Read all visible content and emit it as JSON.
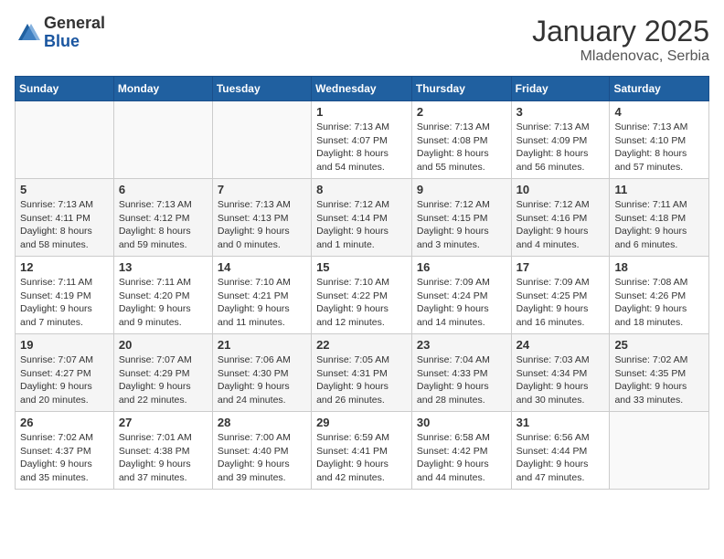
{
  "logo": {
    "general": "General",
    "blue": "Blue"
  },
  "title": "January 2025",
  "location": "Mladenovac, Serbia",
  "weekdays": [
    "Sunday",
    "Monday",
    "Tuesday",
    "Wednesday",
    "Thursday",
    "Friday",
    "Saturday"
  ],
  "weeks": [
    [
      {
        "day": "",
        "info": ""
      },
      {
        "day": "",
        "info": ""
      },
      {
        "day": "",
        "info": ""
      },
      {
        "day": "1",
        "info": "Sunrise: 7:13 AM\nSunset: 4:07 PM\nDaylight: 8 hours\nand 54 minutes."
      },
      {
        "day": "2",
        "info": "Sunrise: 7:13 AM\nSunset: 4:08 PM\nDaylight: 8 hours\nand 55 minutes."
      },
      {
        "day": "3",
        "info": "Sunrise: 7:13 AM\nSunset: 4:09 PM\nDaylight: 8 hours\nand 56 minutes."
      },
      {
        "day": "4",
        "info": "Sunrise: 7:13 AM\nSunset: 4:10 PM\nDaylight: 8 hours\nand 57 minutes."
      }
    ],
    [
      {
        "day": "5",
        "info": "Sunrise: 7:13 AM\nSunset: 4:11 PM\nDaylight: 8 hours\nand 58 minutes."
      },
      {
        "day": "6",
        "info": "Sunrise: 7:13 AM\nSunset: 4:12 PM\nDaylight: 8 hours\nand 59 minutes."
      },
      {
        "day": "7",
        "info": "Sunrise: 7:13 AM\nSunset: 4:13 PM\nDaylight: 9 hours\nand 0 minutes."
      },
      {
        "day": "8",
        "info": "Sunrise: 7:12 AM\nSunset: 4:14 PM\nDaylight: 9 hours\nand 1 minute."
      },
      {
        "day": "9",
        "info": "Sunrise: 7:12 AM\nSunset: 4:15 PM\nDaylight: 9 hours\nand 3 minutes."
      },
      {
        "day": "10",
        "info": "Sunrise: 7:12 AM\nSunset: 4:16 PM\nDaylight: 9 hours\nand 4 minutes."
      },
      {
        "day": "11",
        "info": "Sunrise: 7:11 AM\nSunset: 4:18 PM\nDaylight: 9 hours\nand 6 minutes."
      }
    ],
    [
      {
        "day": "12",
        "info": "Sunrise: 7:11 AM\nSunset: 4:19 PM\nDaylight: 9 hours\nand 7 minutes."
      },
      {
        "day": "13",
        "info": "Sunrise: 7:11 AM\nSunset: 4:20 PM\nDaylight: 9 hours\nand 9 minutes."
      },
      {
        "day": "14",
        "info": "Sunrise: 7:10 AM\nSunset: 4:21 PM\nDaylight: 9 hours\nand 11 minutes."
      },
      {
        "day": "15",
        "info": "Sunrise: 7:10 AM\nSunset: 4:22 PM\nDaylight: 9 hours\nand 12 minutes."
      },
      {
        "day": "16",
        "info": "Sunrise: 7:09 AM\nSunset: 4:24 PM\nDaylight: 9 hours\nand 14 minutes."
      },
      {
        "day": "17",
        "info": "Sunrise: 7:09 AM\nSunset: 4:25 PM\nDaylight: 9 hours\nand 16 minutes."
      },
      {
        "day": "18",
        "info": "Sunrise: 7:08 AM\nSunset: 4:26 PM\nDaylight: 9 hours\nand 18 minutes."
      }
    ],
    [
      {
        "day": "19",
        "info": "Sunrise: 7:07 AM\nSunset: 4:27 PM\nDaylight: 9 hours\nand 20 minutes."
      },
      {
        "day": "20",
        "info": "Sunrise: 7:07 AM\nSunset: 4:29 PM\nDaylight: 9 hours\nand 22 minutes."
      },
      {
        "day": "21",
        "info": "Sunrise: 7:06 AM\nSunset: 4:30 PM\nDaylight: 9 hours\nand 24 minutes."
      },
      {
        "day": "22",
        "info": "Sunrise: 7:05 AM\nSunset: 4:31 PM\nDaylight: 9 hours\nand 26 minutes."
      },
      {
        "day": "23",
        "info": "Sunrise: 7:04 AM\nSunset: 4:33 PM\nDaylight: 9 hours\nand 28 minutes."
      },
      {
        "day": "24",
        "info": "Sunrise: 7:03 AM\nSunset: 4:34 PM\nDaylight: 9 hours\nand 30 minutes."
      },
      {
        "day": "25",
        "info": "Sunrise: 7:02 AM\nSunset: 4:35 PM\nDaylight: 9 hours\nand 33 minutes."
      }
    ],
    [
      {
        "day": "26",
        "info": "Sunrise: 7:02 AM\nSunset: 4:37 PM\nDaylight: 9 hours\nand 35 minutes."
      },
      {
        "day": "27",
        "info": "Sunrise: 7:01 AM\nSunset: 4:38 PM\nDaylight: 9 hours\nand 37 minutes."
      },
      {
        "day": "28",
        "info": "Sunrise: 7:00 AM\nSunset: 4:40 PM\nDaylight: 9 hours\nand 39 minutes."
      },
      {
        "day": "29",
        "info": "Sunrise: 6:59 AM\nSunset: 4:41 PM\nDaylight: 9 hours\nand 42 minutes."
      },
      {
        "day": "30",
        "info": "Sunrise: 6:58 AM\nSunset: 4:42 PM\nDaylight: 9 hours\nand 44 minutes."
      },
      {
        "day": "31",
        "info": "Sunrise: 6:56 AM\nSunset: 4:44 PM\nDaylight: 9 hours\nand 47 minutes."
      },
      {
        "day": "",
        "info": ""
      }
    ]
  ]
}
